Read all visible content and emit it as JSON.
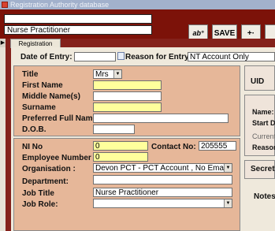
{
  "window": {
    "title": "Registration Authority database"
  },
  "header": {
    "name_value": "",
    "role_value": "Nurse Practitioner",
    "buttons": {
      "spell_label": "ab°",
      "save_label": "SAVE",
      "add_label": "+·"
    }
  },
  "record_selector": "▶",
  "tab": {
    "label": "Registration Details"
  },
  "entry": {
    "date_label": "Date of Entry:",
    "date_value": "",
    "reason_label": "Reason for Entry:",
    "reason_value": "NT Account Only"
  },
  "personal": {
    "title_label": "Title",
    "title_value": "Mrs",
    "first_name_label": "First Name",
    "first_name_value": "",
    "middle_name_label": "Middle Name(s)",
    "middle_name_value": "",
    "surname_label": "Surname",
    "surname_value": "",
    "preferred_label": "Preferred Full Name",
    "preferred_value": "",
    "dob_label": "D.O.B.",
    "dob_value": ""
  },
  "employment": {
    "ni_label": "NI No",
    "ni_value": "0",
    "contact_label": "Contact No:",
    "contact_value": "205555",
    "employee_label": "Employee Number",
    "employee_value": "0",
    "org_label": "Organisation :",
    "org_value": "Devon PCT - PCT Account , No Email",
    "dept_label": "Department:",
    "dept_value": "",
    "job_title_label": "Job Title",
    "job_title_value": "Nurse Practitioner",
    "job_role_label": "Job Role:",
    "job_role_value": ""
  },
  "right_panel": {
    "uid_label": "UID",
    "name_label": "Name:",
    "start_label": "Start D",
    "current_label": "Current",
    "reason_label": "Reason",
    "secret_label": "Secret",
    "notes_label": "Notes"
  },
  "colors": {
    "frame": "#7c1209",
    "panel": "#efe9dc",
    "group": "#e6b799",
    "required": "#ffff9c"
  }
}
